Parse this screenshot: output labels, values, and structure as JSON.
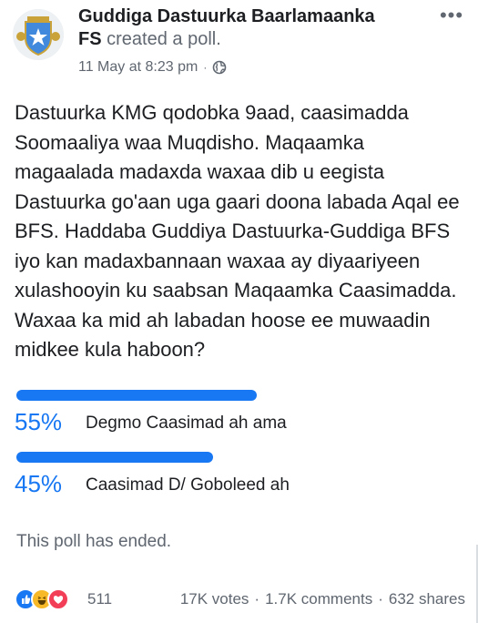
{
  "post": {
    "page_name": "Guddiga Dastuurka Baarlamaanka",
    "author": "FS",
    "action": "created a poll.",
    "timestamp": "11 May at 8:23 pm",
    "separator": "·",
    "privacy_icon": "globe-icon",
    "more_icon": "more-horizontal-icon",
    "more_label": "•••",
    "text": "Dastuurka KMG qodobka 9aad, caasimadda Soomaaliya waa Muqdisho. Maqaamka magaalada madaxda waxaa dib u eegista Dastuurka go'aan uga gaari doona labada Aqal ee BFS. Haddaba Guddiya Dastuurka-Guddiga BFS iyo kan madaxbannaan waxaa ay diyaariyeen xulashooyin ku saabsan Maqaamka Caasimadda. Waxaa ka mid ah labadan hoose ee muwaadin midkee kula haboon?"
  },
  "poll": {
    "options": [
      {
        "percent_label": "55%",
        "fraction": 0.55,
        "label": "Degmo Caasimad ah ama"
      },
      {
        "percent_label": "45%",
        "fraction": 0.45,
        "label": "Caasimad D/ Goboleed ah"
      }
    ],
    "status": "This poll has ended."
  },
  "footer": {
    "reaction_icons": [
      "like-icon",
      "haha-icon",
      "love-icon"
    ],
    "reaction_count": "511",
    "votes": "17K votes",
    "comments": "1.7K comments",
    "shares": "632 shares",
    "separator": "·"
  },
  "colors": {
    "accent": "#1877f2",
    "text": "#1c1e21",
    "secondary_text": "#606770"
  }
}
